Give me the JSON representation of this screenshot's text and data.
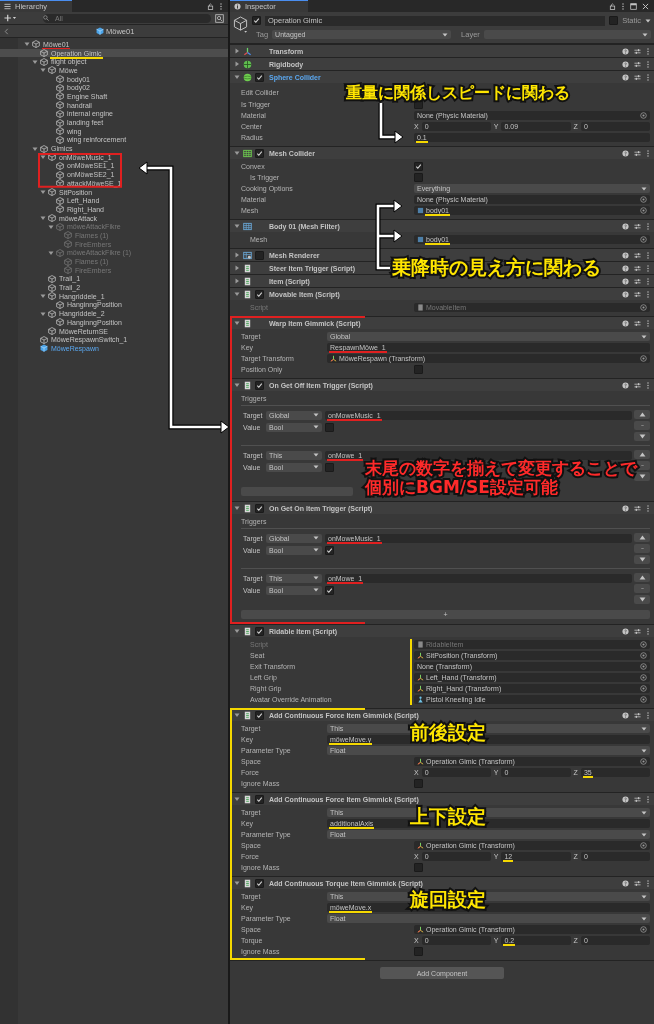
{
  "hierarchy": {
    "tab": "Hierarchy",
    "search": {
      "placeholder": "All"
    },
    "scene": "Möwe01",
    "tree": [
      {
        "label": "Möwe01",
        "selected": false,
        "disabled": false,
        "prefab": false,
        "expanded": true,
        "underline": {
          "color": "#e02020"
        },
        "children": [
          {
            "label": "Operation Gimic",
            "selected": true,
            "disabled": false,
            "prefab": false,
            "underline": {
              "color": "#f5d800"
            }
          },
          {
            "label": "flight object",
            "selected": false,
            "disabled": false,
            "prefab": false,
            "expanded": true,
            "children": [
              {
                "label": "Möwe",
                "selected": false,
                "disabled": false,
                "prefab": false,
                "expanded": true,
                "children": [
                  {
                    "label": "body01",
                    "selected": false,
                    "disabled": false,
                    "prefab": false
                  },
                  {
                    "label": "body02",
                    "selected": false,
                    "disabled": false,
                    "prefab": false
                  },
                  {
                    "label": "Engine Shaft",
                    "selected": false,
                    "disabled": false,
                    "prefab": false
                  },
                  {
                    "label": "handrail",
                    "selected": false,
                    "disabled": false,
                    "prefab": false
                  },
                  {
                    "label": "internal engine",
                    "selected": false,
                    "disabled": false,
                    "prefab": false
                  },
                  {
                    "label": "landing feet",
                    "selected": false,
                    "disabled": false,
                    "prefab": false
                  },
                  {
                    "label": "wing",
                    "selected": false,
                    "disabled": false,
                    "prefab": false
                  },
                  {
                    "label": "wing reinforcement",
                    "selected": false,
                    "disabled": false,
                    "prefab": false
                  }
                ]
              }
            ]
          },
          {
            "label": "Gimics",
            "selected": false,
            "disabled": false,
            "prefab": false,
            "expanded": true,
            "children": [
              {
                "label": "onMöweMusic_1",
                "selected": false,
                "disabled": false,
                "prefab": false,
                "expanded": true,
                "box": {
                  "color": "#e02020"
                },
                "children": [
                  {
                    "label": "onMöweSE1_1",
                    "selected": false,
                    "disabled": false,
                    "prefab": false
                  },
                  {
                    "label": "onMöweSE2_1",
                    "selected": false,
                    "disabled": false,
                    "prefab": false
                  },
                  {
                    "label": "attackMöweSE_1",
                    "selected": false,
                    "disabled": false,
                    "prefab": false
                  }
                ]
              },
              {
                "label": "SitPosition",
                "selected": false,
                "disabled": false,
                "prefab": false,
                "expanded": true,
                "children": [
                  {
                    "label": "Left_Hand",
                    "selected": false,
                    "disabled": false,
                    "prefab": false
                  },
                  {
                    "label": "Right_Hand",
                    "selected": false,
                    "disabled": false,
                    "prefab": false
                  }
                ]
              },
              {
                "label": "möweAttack",
                "selected": false,
                "disabled": false,
                "prefab": false,
                "expanded": true,
                "children": [
                  {
                    "label": "möweAttackFikre",
                    "selected": false,
                    "disabled": true,
                    "prefab": false,
                    "expanded": true,
                    "children": [
                      {
                        "label": "Flames (1)",
                        "selected": false,
                        "disabled": true,
                        "prefab": false
                      },
                      {
                        "label": "FireEmbers",
                        "selected": false,
                        "disabled": true,
                        "prefab": false
                      }
                    ]
                  },
                  {
                    "label": "möweAttackFikre (1)",
                    "selected": false,
                    "disabled": true,
                    "prefab": false,
                    "expanded": true,
                    "children": [
                      {
                        "label": "Flames (1)",
                        "selected": false,
                        "disabled": true,
                        "prefab": false
                      },
                      {
                        "label": "FireEmbers",
                        "selected": false,
                        "disabled": true,
                        "prefab": false
                      }
                    ]
                  }
                ]
              },
              {
                "label": "Trail_1",
                "selected": false,
                "disabled": false,
                "prefab": false
              },
              {
                "label": "Trail_2",
                "selected": false,
                "disabled": false,
                "prefab": false
              },
              {
                "label": "Hangriddele_1",
                "selected": false,
                "disabled": false,
                "prefab": false,
                "expanded": true,
                "children": [
                  {
                    "label": "HanginngPosition",
                    "selected": false,
                    "disabled": false,
                    "prefab": false
                  }
                ]
              },
              {
                "label": "Hangriddele_2",
                "selected": false,
                "disabled": false,
                "prefab": false,
                "expanded": true,
                "children": [
                  {
                    "label": "HanginngPosition",
                    "selected": false,
                    "disabled": false,
                    "prefab": false
                  }
                ]
              },
              {
                "label": "MöweReturnSE",
                "selected": false,
                "disabled": false,
                "prefab": false
              }
            ]
          },
          {
            "label": "MöweRespawnSwitch_1",
            "selected": false,
            "disabled": false,
            "prefab": false
          },
          {
            "label": "MöweRespawn",
            "selected": false,
            "disabled": false,
            "prefab": true
          }
        ]
      }
    ]
  },
  "inspector": {
    "tab": "Inspector",
    "object": {
      "active": true,
      "name": "Operation Gimic",
      "static": false,
      "static_label": "Static",
      "tag_label": "Tag",
      "tag": "Untagged",
      "layer_label": "Layer"
    },
    "components": [
      {
        "title": "Transform",
        "kind": "transform",
        "expanded": false,
        "highlighted": false
      },
      {
        "title": "Rigidbody",
        "kind": "rigidbody",
        "expanded": false,
        "highlighted": false
      },
      {
        "title": "Sphere Collider",
        "kind": "sphere-collider",
        "enabled": true,
        "expanded": true,
        "highlighted": true,
        "fields": [
          {
            "kind": "label",
            "label": "Edit Collider"
          },
          {
            "kind": "checkbox",
            "label": "Is Trigger",
            "checked": false
          },
          {
            "kind": "object",
            "label": "Material",
            "value": "None (Physic Material)"
          },
          {
            "kind": "vector",
            "label": "Center",
            "axes": [
              {
                "axis": "X",
                "value": "0"
              },
              {
                "axis": "Y",
                "value": "0.09"
              },
              {
                "axis": "Z",
                "value": "0"
              }
            ]
          },
          {
            "kind": "number",
            "label": "Radius",
            "value": "0.1",
            "underline": {
              "color": "#f5d800"
            }
          }
        ]
      },
      {
        "title": "Mesh Collider",
        "kind": "mesh-collider",
        "enabled": true,
        "expanded": true,
        "highlighted": false,
        "fields": [
          {
            "kind": "checkbox",
            "label": "Convex",
            "checked": true
          },
          {
            "kind": "checkbox",
            "label": "Is Trigger",
            "checked": false,
            "sub": true
          },
          {
            "kind": "dropdown",
            "label": "Cooking Options",
            "value": "Everything"
          },
          {
            "kind": "object",
            "label": "Material",
            "value": "None (Physic Material)"
          },
          {
            "kind": "mesh-object",
            "label": "Mesh",
            "value": "body01",
            "underline": {
              "color": "#f5d800"
            }
          }
        ]
      },
      {
        "title": "Body 01 (Mesh Filter)",
        "kind": "mesh-filter",
        "expanded": true,
        "highlighted": false,
        "fields": [
          {
            "kind": "mesh-object",
            "label": "Mesh",
            "value": "body01",
            "underline": {
              "color": "#f5d800"
            },
            "sub": true
          }
        ]
      },
      {
        "title": "Mesh Renderer",
        "kind": "mesh-renderer",
        "enabled": false,
        "expanded": false,
        "highlighted": false
      },
      {
        "title": "Steer Item Trigger (Script)",
        "kind": "script",
        "expanded": false,
        "highlighted": false
      },
      {
        "title": "Item (Script)",
        "kind": "script",
        "expanded": false,
        "highlighted": false
      },
      {
        "title": "Movable Item (Script)",
        "kind": "script",
        "enabled": true,
        "expanded": true,
        "highlighted": false,
        "fields": [
          {
            "kind": "script-object",
            "label": "Script",
            "value": "MovableItem",
            "disabled": true,
            "sub": true
          }
        ]
      },
      {
        "title": "Warp Item Gimmick (Script)",
        "kind": "script",
        "expanded": true,
        "highlighted": false,
        "bracket": {
          "color": "#e02020"
        },
        "fields": [
          {
            "kind": "dropdown",
            "label": "Target",
            "value": "Global",
            "short_label": true
          },
          {
            "kind": "text",
            "label": "Key",
            "value": "RespawnMöwe_1",
            "underline": {
              "color": "#e02020"
            },
            "short_label": true
          },
          {
            "kind": "transform-object",
            "label": "Target Transform",
            "value": "MöweRespawn (Transform)",
            "short_label": true
          },
          {
            "kind": "checkbox",
            "label": "Position Only",
            "checked": false
          }
        ]
      },
      {
        "title": "On Get Off Item Trigger (Script)",
        "kind": "script",
        "enabled": true,
        "expanded": true,
        "highlighted": false,
        "bracket": {
          "color": "#e02020"
        },
        "fields": [
          {
            "kind": "triggers",
            "label": "Triggers",
            "items": [
              {
                "target_label": "Target",
                "target": "Global",
                "key": "onMoweMusic_1",
                "key_underline": {
                  "color": "#e02020"
                },
                "value_label": "Value",
                "type": "Bool",
                "checked": false
              },
              {
                "target_label": "Target",
                "target": "This",
                "key": "onMowe_1",
                "key_underline": {
                  "color": "#e02020"
                },
                "value_label": "Value",
                "type": "Bool",
                "checked": false
              }
            ]
          }
        ]
      },
      {
        "title": "On Get On Item Trigger (Script)",
        "kind": "script",
        "enabled": true,
        "expanded": true,
        "highlighted": false,
        "bracket": {
          "color": "#e02020"
        },
        "fields": [
          {
            "kind": "triggers",
            "label": "Triggers",
            "add": "+",
            "items": [
              {
                "target_label": "Target",
                "target": "Global",
                "key": "onMoweMusic_1",
                "key_underline": {
                  "color": "#e02020"
                },
                "value_label": "Value",
                "type": "Bool",
                "checked": true
              },
              {
                "target_label": "Target",
                "target": "This",
                "key": "onMowe_1",
                "key_underline": {
                  "color": "#e02020"
                },
                "value_label": "Value",
                "type": "Bool",
                "checked": true
              }
            ]
          }
        ]
      },
      {
        "title": "Ridable Item (Script)",
        "kind": "script",
        "enabled": true,
        "expanded": true,
        "highlighted": false,
        "value_bracket": {
          "color": "#f5d800"
        },
        "fields": [
          {
            "kind": "script-object",
            "label": "Script",
            "value": "RidableItem",
            "disabled": true,
            "sub": true
          },
          {
            "kind": "transform-object",
            "label": "Seat",
            "value": "SitPosition (Transform)",
            "sub": true
          },
          {
            "kind": "object",
            "label": "Exit Transform",
            "value": "None (Transform)",
            "sub": true
          },
          {
            "kind": "transform-object",
            "label": "Left Grip",
            "value": "Left_Hand (Transform)",
            "sub": true
          },
          {
            "kind": "transform-object",
            "label": "Right Grip",
            "value": "Right_Hand (Transform)",
            "sub": true
          },
          {
            "kind": "animation-object",
            "label": "Avatar Override Animation",
            "value": "Pistol Kneeling Idle",
            "sub": true
          }
        ]
      },
      {
        "title": "Add Continuous Force Item Gimmick (Script)",
        "kind": "script",
        "enabled": true,
        "expanded": true,
        "highlighted": false,
        "bracket": {
          "color": "#f5d800"
        },
        "fields": [
          {
            "kind": "dropdown",
            "label": "Target",
            "value": "This",
            "short_label": true
          },
          {
            "kind": "text",
            "label": "Key",
            "value": "möweMove.y",
            "underline": {
              "color": "#f5d800"
            },
            "short_label": true
          },
          {
            "kind": "dropdown",
            "label": "Parameter Type",
            "value": "Float",
            "short_label": true
          },
          {
            "kind": "transform-object",
            "label": "Space",
            "value": "Operation Gimic (Transform)"
          },
          {
            "kind": "vector",
            "label": "Force",
            "axes": [
              {
                "axis": "X",
                "value": "0"
              },
              {
                "axis": "Y",
                "value": "0"
              },
              {
                "axis": "Z",
                "value": "35",
                "underline": {
                  "color": "#f5d800"
                }
              }
            ]
          },
          {
            "kind": "checkbox",
            "label": "Ignore Mass",
            "checked": false
          }
        ]
      },
      {
        "title": "Add Continuous Force Item Gimmick (Script)",
        "kind": "script",
        "enabled": true,
        "expanded": true,
        "highlighted": false,
        "bracket": {
          "color": "#f5d800"
        },
        "fields": [
          {
            "kind": "dropdown",
            "label": "Target",
            "value": "This",
            "short_label": true
          },
          {
            "kind": "text",
            "label": "Key",
            "value": "additionalAxis",
            "underline": {
              "color": "#f5d800"
            },
            "short_label": true
          },
          {
            "kind": "dropdown",
            "label": "Parameter Type",
            "value": "Float",
            "short_label": true
          },
          {
            "kind": "transform-object",
            "label": "Space",
            "value": "Operation Gimic (Transform)"
          },
          {
            "kind": "vector",
            "label": "Force",
            "axes": [
              {
                "axis": "X",
                "value": "0"
              },
              {
                "axis": "Y",
                "value": "12",
                "underline": {
                  "color": "#f5d800"
                }
              },
              {
                "axis": "Z",
                "value": "0"
              }
            ]
          },
          {
            "kind": "checkbox",
            "label": "Ignore Mass",
            "checked": false
          }
        ]
      },
      {
        "title": "Add Continuous Torque Item Gimmick (Script)",
        "kind": "script",
        "enabled": true,
        "expanded": true,
        "highlighted": false,
        "bracket": {
          "color": "#f5d800"
        },
        "fields": [
          {
            "kind": "dropdown",
            "label": "Target",
            "value": "This",
            "short_label": true
          },
          {
            "kind": "text",
            "label": "Key",
            "value": "möweMove.x",
            "underline": {
              "color": "#f5d800"
            },
            "short_label": true
          },
          {
            "kind": "dropdown",
            "label": "Parameter Type",
            "value": "Float",
            "short_label": true
          },
          {
            "kind": "transform-object",
            "label": "Space",
            "value": "Operation Gimic (Transform)"
          },
          {
            "kind": "vector",
            "label": "Torque",
            "axes": [
              {
                "axis": "X",
                "value": "0"
              },
              {
                "axis": "Y",
                "value": "0.2",
                "underline": {
                  "color": "#f5d800"
                }
              },
              {
                "axis": "Z",
                "value": "0"
              }
            ]
          },
          {
            "kind": "checkbox",
            "label": "Ignore Mass",
            "checked": false
          }
        ]
      }
    ],
    "add_component": "Add Component"
  },
  "callouts": [
    {
      "lines": [
        "重量に関係しスピードに関わる"
      ],
      "color": "#ffe600"
    },
    {
      "lines": [
        "乗降時の見え方に関わる"
      ],
      "color": "#ffe600"
    },
    {
      "lines": [
        "末尾の数字を揃えて変更することで",
        "個別にBGM/SE設定可能"
      ],
      "color": "#ff2a2a"
    },
    {
      "lines": [
        "前後設定"
      ],
      "color": "#ffe600"
    },
    {
      "lines": [
        "上下設定"
      ],
      "color": "#ffe600"
    },
    {
      "lines": [
        "旋回設定"
      ],
      "color": "#ffe600"
    }
  ]
}
